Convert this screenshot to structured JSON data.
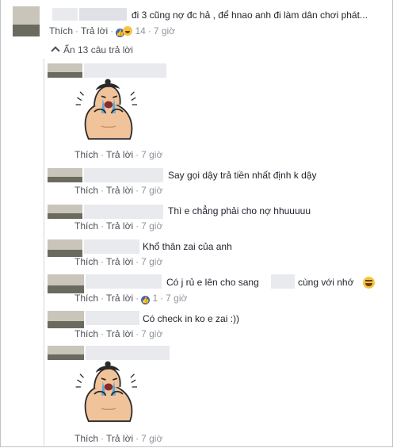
{
  "top_comment": {
    "text": "đi 3 cũng nợ đc hả , để hnao anh đi làm dân chơi phát...",
    "like_label": "Thích",
    "reply_label": "Trả lời",
    "reaction_count": "14",
    "time": "7 giờ"
  },
  "replies_toggle": "Ẩn 13 câu trả lời",
  "replies": [
    {
      "type": "sticker",
      "icon": "crying-sumo-sticker",
      "like_label": "Thích",
      "reply_label": "Trả lời",
      "time": "7 giờ"
    },
    {
      "type": "text",
      "text": "Say gọi dậy trả tiền nhất định k dậy",
      "like_label": "Thích",
      "reply_label": "Trả lời",
      "time": "7 giờ"
    },
    {
      "type": "text",
      "text": "Thì e chẳng phải cho nợ hhuuuuu",
      "like_label": "Thích",
      "reply_label": "Trả lời",
      "time": "7 giờ"
    },
    {
      "type": "text",
      "text": "Khổ thân zai của anh",
      "like_label": "Thích",
      "reply_label": "Trả lời",
      "time": "7 giờ"
    },
    {
      "type": "text",
      "text_before": "Có j rủ e lên cho sang",
      "text_after": "cùng với nhớ",
      "icon": "laughing-emoji",
      "like_label": "Thích",
      "reply_label": "Trả lời",
      "reaction_count": "1",
      "time": "7 giờ"
    },
    {
      "type": "text",
      "text": "Có check in ko e zai :))",
      "like_label": "Thích",
      "reply_label": "Trả lời",
      "time": "7 giờ"
    },
    {
      "type": "sticker",
      "icon": "crying-sumo-sticker",
      "like_label": "Thích",
      "reply_label": "Trả lời",
      "time": "7 giờ"
    }
  ]
}
